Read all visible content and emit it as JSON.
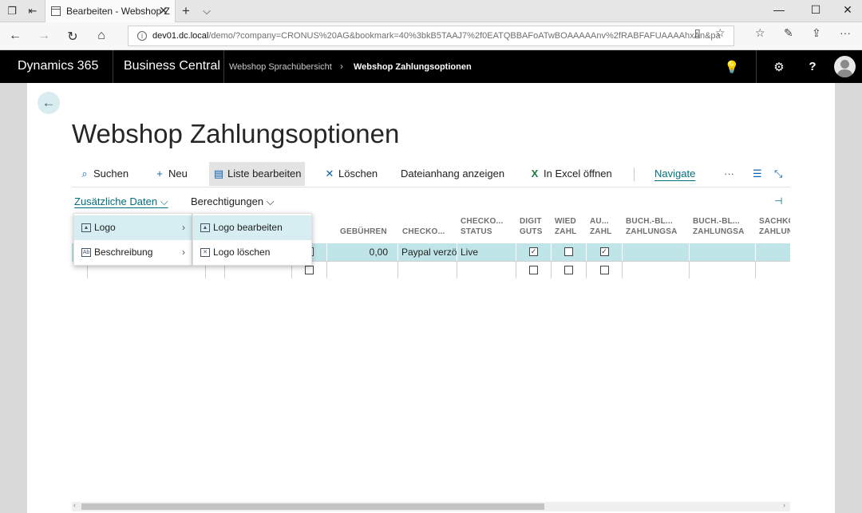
{
  "browser": {
    "tab_title": "Bearbeiten - Webshop Z",
    "url_host": "dev01.dc.local",
    "url_rest": "/demo/?company=CRONUS%20AG&bookmark=40%3bkB5TAAJ7%2f0EATQBBAFoATwBOAAAAAnv%2fRABFAFUAAAAhxAn&pa",
    "close_glyph": "✕",
    "new_tab_glyph": "+",
    "tab_menu_glyph": "⌵"
  },
  "header": {
    "product": "Dynamics 365",
    "app": "Business Central",
    "breadcrumb": [
      "Webshop Sprachübersicht",
      "Webshop Zahlungsoptionen"
    ]
  },
  "page": {
    "title": "Webshop Zahlungsoptionen"
  },
  "actions": [
    {
      "label": "Suchen",
      "icon": "search-icon"
    },
    {
      "label": "Neu",
      "icon": "plus-icon"
    },
    {
      "label": "Liste bearbeiten",
      "icon": "edit-list-icon"
    },
    {
      "label": "Löschen",
      "icon": "delete-icon"
    },
    {
      "label": "Dateianhang anzeigen",
      "icon": ""
    },
    {
      "label": "In Excel öffnen",
      "icon": "excel-icon"
    },
    {
      "label": "Navigate",
      "icon": ""
    }
  ],
  "subactions": {
    "extra_data": "Zusätzliche Daten",
    "permissions": "Berechtigungen"
  },
  "menu_main": [
    {
      "label": "Logo"
    },
    {
      "label": "Beschreibung"
    }
  ],
  "menu_sub": [
    {
      "label": "Logo bearbeiten"
    },
    {
      "label": "Logo löschen"
    }
  ],
  "columns": {
    "fees": "GEBÜHREN",
    "checkout": "CHECKO...",
    "checkout_status_1": "CHECKO...",
    "checkout_status_2": "STATUS",
    "digit_1": "DIGIT",
    "digit_2": "GUTS",
    "wied_1": "WIED",
    "wied_2": "ZAHL",
    "au_1": "AU...",
    "au_2": "ZAHL",
    "buch1_1": "BUCH.-BL...",
    "buch1_2": "ZAHLUNGSA",
    "buch2_1": "BUCH.-BL...",
    "buch2_2": "ZAHLUNGSA",
    "sach_1": "SACHKO",
    "sach_2": "ZAHLUN"
  },
  "rows": [
    {
      "fees": "0,00",
      "checkout": "Paypal verzö",
      "status": "Live",
      "digit": true,
      "wied": false,
      "au": true,
      "first_checkbox": false
    },
    {
      "fees": "",
      "checkout": "",
      "status": "",
      "digit": false,
      "wied": false,
      "au": false,
      "first_checkbox": false
    }
  ],
  "colors": {
    "accent": "#00707c",
    "selected_row": "#c0e5e9",
    "header_bg": "#000000"
  }
}
